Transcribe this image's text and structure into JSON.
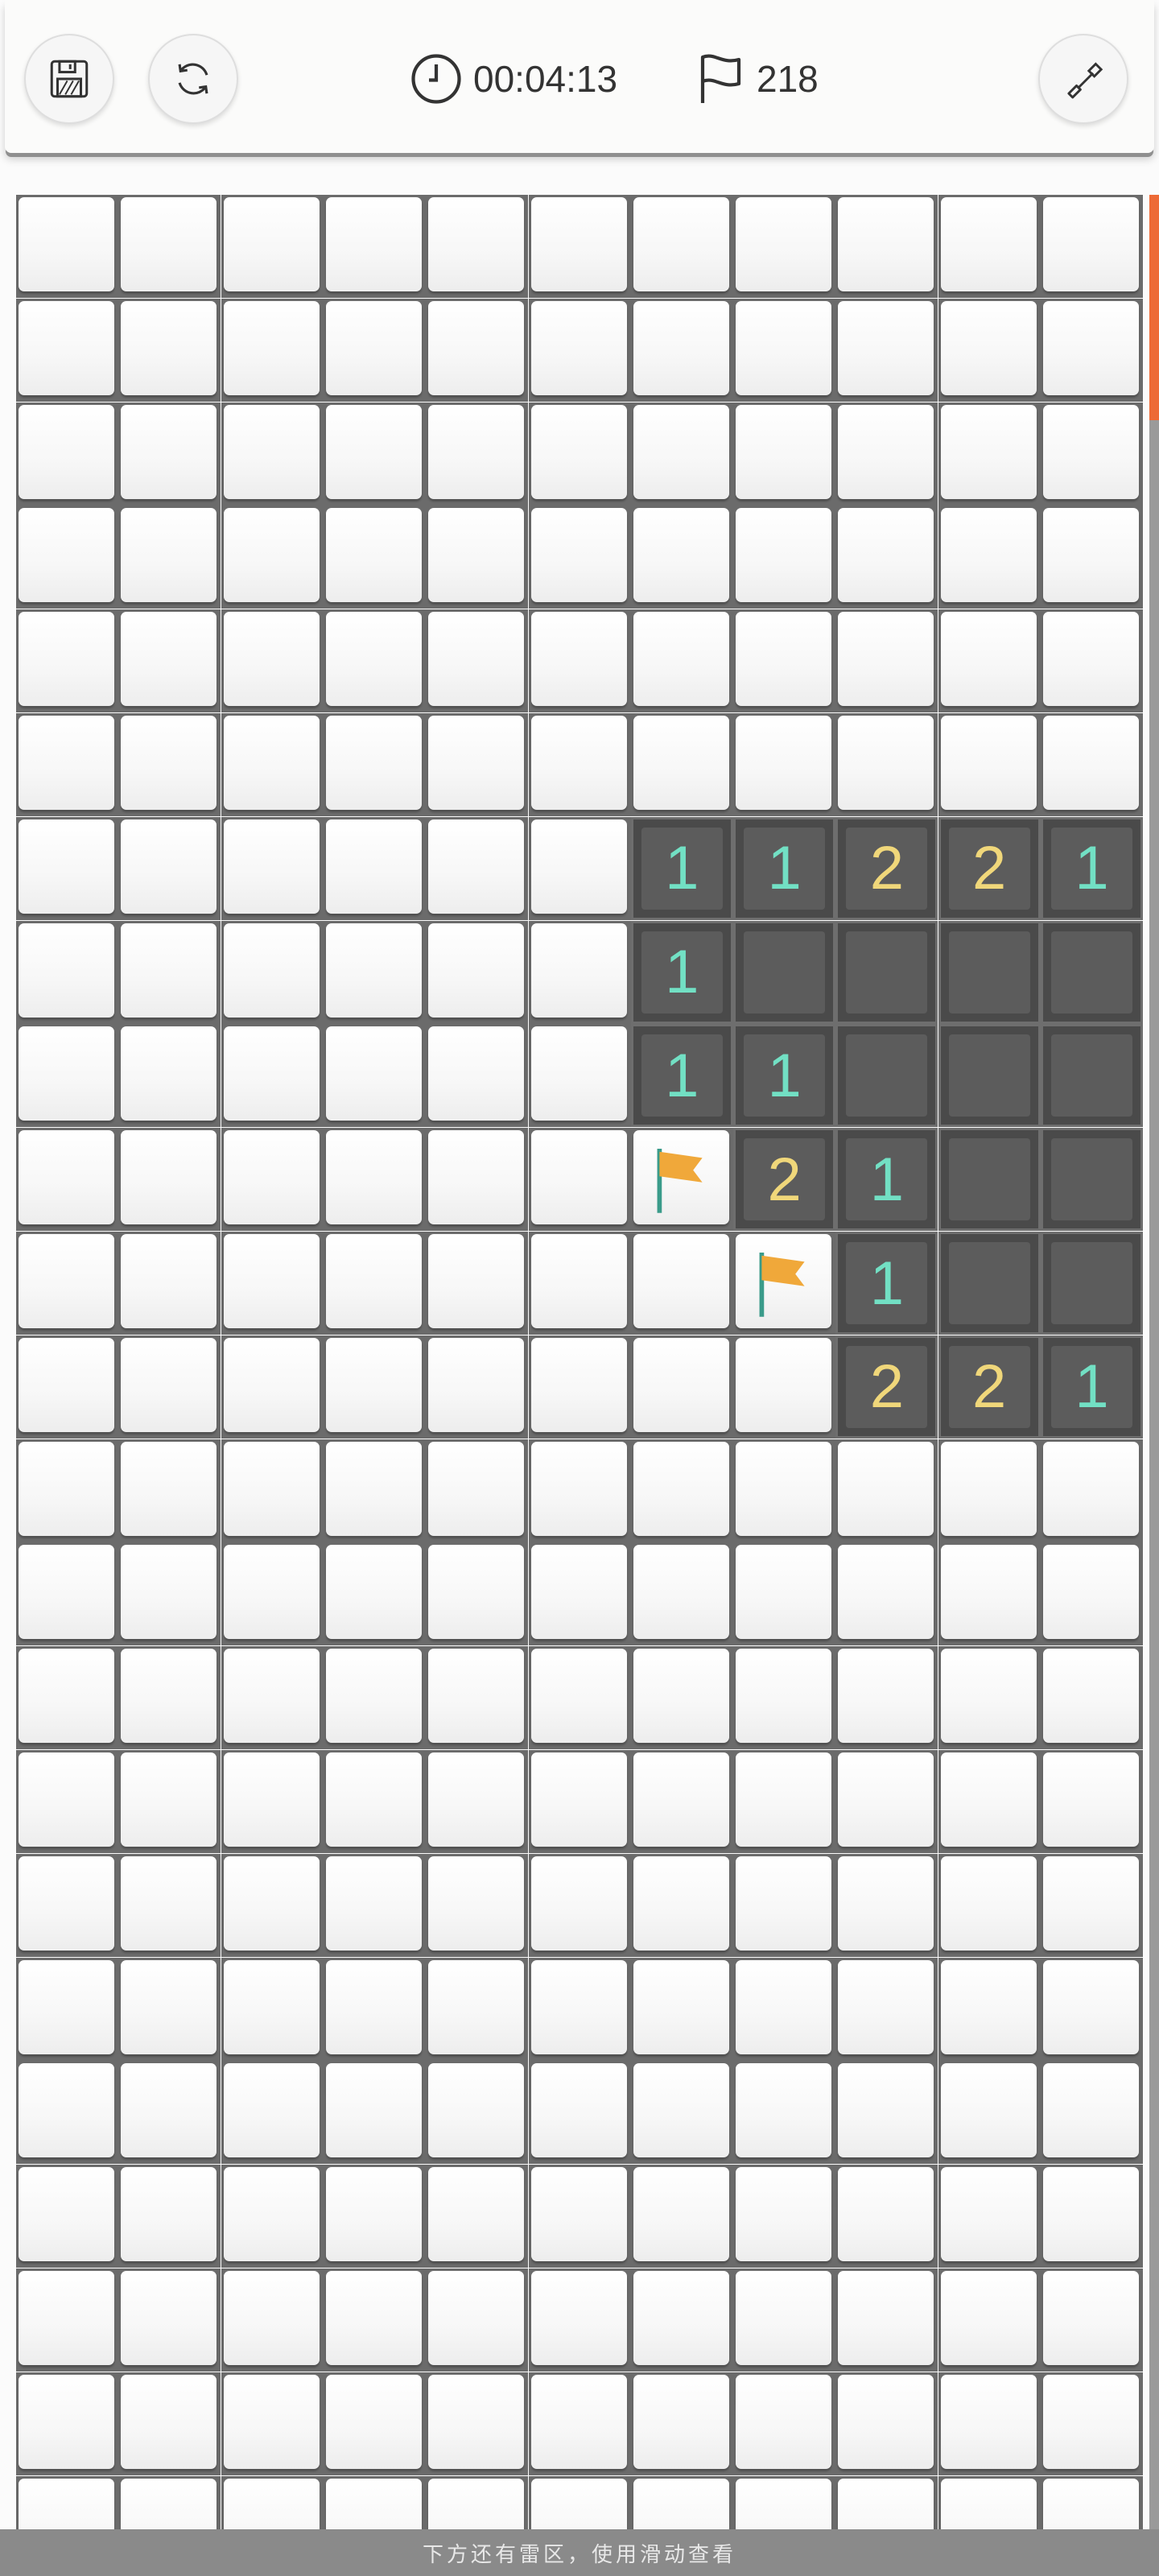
{
  "header": {
    "timer": "00:04:13",
    "flags_remaining": "218",
    "icons": [
      "save-icon",
      "restart-icon",
      "clock-icon",
      "flag-icon",
      "shovel-icon"
    ]
  },
  "board": {
    "visible_rows": 23,
    "columns": 11,
    "revealed": [
      {
        "row": 6,
        "col": 6,
        "state": "number",
        "value": "1"
      },
      {
        "row": 6,
        "col": 7,
        "state": "number",
        "value": "1"
      },
      {
        "row": 6,
        "col": 8,
        "state": "number",
        "value": "2"
      },
      {
        "row": 6,
        "col": 9,
        "state": "number",
        "value": "2"
      },
      {
        "row": 6,
        "col": 10,
        "state": "number",
        "value": "1"
      },
      {
        "row": 7,
        "col": 6,
        "state": "number",
        "value": "1"
      },
      {
        "row": 7,
        "col": 7,
        "state": "empty",
        "value": ""
      },
      {
        "row": 7,
        "col": 8,
        "state": "empty",
        "value": ""
      },
      {
        "row": 7,
        "col": 9,
        "state": "empty",
        "value": ""
      },
      {
        "row": 7,
        "col": 10,
        "state": "empty",
        "value": ""
      },
      {
        "row": 8,
        "col": 6,
        "state": "number",
        "value": "1"
      },
      {
        "row": 8,
        "col": 7,
        "state": "number",
        "value": "1"
      },
      {
        "row": 8,
        "col": 8,
        "state": "empty",
        "value": ""
      },
      {
        "row": 8,
        "col": 9,
        "state": "empty",
        "value": ""
      },
      {
        "row": 8,
        "col": 10,
        "state": "empty",
        "value": ""
      },
      {
        "row": 9,
        "col": 6,
        "state": "flag",
        "value": ""
      },
      {
        "row": 9,
        "col": 7,
        "state": "number",
        "value": "2"
      },
      {
        "row": 9,
        "col": 8,
        "state": "number",
        "value": "1"
      },
      {
        "row": 9,
        "col": 9,
        "state": "empty",
        "value": ""
      },
      {
        "row": 9,
        "col": 10,
        "state": "empty",
        "value": ""
      },
      {
        "row": 10,
        "col": 7,
        "state": "flag",
        "value": ""
      },
      {
        "row": 10,
        "col": 8,
        "state": "number",
        "value": "1"
      },
      {
        "row": 10,
        "col": 9,
        "state": "empty",
        "value": ""
      },
      {
        "row": 10,
        "col": 10,
        "state": "empty",
        "value": ""
      },
      {
        "row": 11,
        "col": 8,
        "state": "number",
        "value": "2"
      },
      {
        "row": 11,
        "col": 9,
        "state": "number",
        "value": "2"
      },
      {
        "row": 11,
        "col": 10,
        "state": "number",
        "value": "1"
      }
    ],
    "colors": {
      "number_1": "#72e0c4",
      "number_2": "#f0d77a",
      "revealed_bg": "#5c5c5c",
      "flag": "#f0a83a",
      "flag_pole": "#3a9b8a"
    }
  },
  "scroll_hint": "下方还有雷区，使用滑动查看",
  "accent_color": "#ed6a36"
}
